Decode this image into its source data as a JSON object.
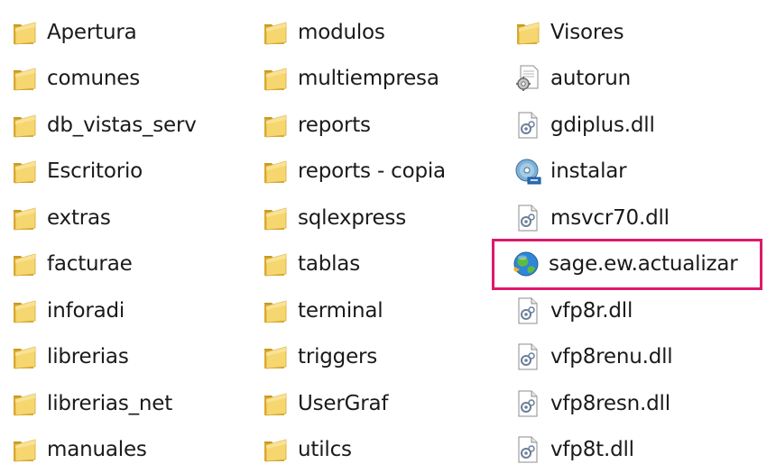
{
  "explorer": {
    "columns": [
      {
        "items": [
          {
            "label": "Apertura",
            "icon": "folder-icon"
          },
          {
            "label": "comunes",
            "icon": "folder-icon"
          },
          {
            "label": "db_vistas_serv",
            "icon": "folder-icon"
          },
          {
            "label": "Escritorio",
            "icon": "folder-icon"
          },
          {
            "label": "extras",
            "icon": "folder-icon"
          },
          {
            "label": "facturae",
            "icon": "folder-icon"
          },
          {
            "label": "inforadi",
            "icon": "folder-icon"
          },
          {
            "label": "librerias",
            "icon": "folder-icon"
          },
          {
            "label": "librerias_net",
            "icon": "folder-icon"
          },
          {
            "label": "manuales",
            "icon": "folder-icon"
          }
        ]
      },
      {
        "items": [
          {
            "label": "modulos",
            "icon": "folder-icon"
          },
          {
            "label": "multiempresa",
            "icon": "folder-icon"
          },
          {
            "label": "reports",
            "icon": "folder-icon"
          },
          {
            "label": "reports - copia",
            "icon": "folder-icon"
          },
          {
            "label": "sqlexpress",
            "icon": "folder-icon"
          },
          {
            "label": "tablas",
            "icon": "folder-icon"
          },
          {
            "label": "terminal",
            "icon": "folder-icon"
          },
          {
            "label": "triggers",
            "icon": "folder-icon"
          },
          {
            "label": "UserGraf",
            "icon": "folder-icon"
          },
          {
            "label": "utilcs",
            "icon": "folder-icon"
          }
        ]
      },
      {
        "items": [
          {
            "label": "Visores",
            "icon": "folder-icon"
          },
          {
            "label": "autorun",
            "icon": "autorun-settings-icon"
          },
          {
            "label": "gdiplus.dll",
            "icon": "dll-file-icon"
          },
          {
            "label": "instalar",
            "icon": "installer-disc-icon"
          },
          {
            "label": "msvcr70.dll",
            "icon": "dll-file-icon"
          },
          {
            "label": "sage.ew.actualizar",
            "icon": "globe-app-icon",
            "highlighted": true
          },
          {
            "label": "vfp8r.dll",
            "icon": "dll-file-icon"
          },
          {
            "label": "vfp8renu.dll",
            "icon": "dll-file-icon"
          },
          {
            "label": "vfp8resn.dll",
            "icon": "dll-file-icon"
          },
          {
            "label": "vfp8t.dll",
            "icon": "dll-file-icon"
          }
        ]
      }
    ],
    "highlight_color": "#e0186c",
    "folder_color": "#f2c94c"
  }
}
